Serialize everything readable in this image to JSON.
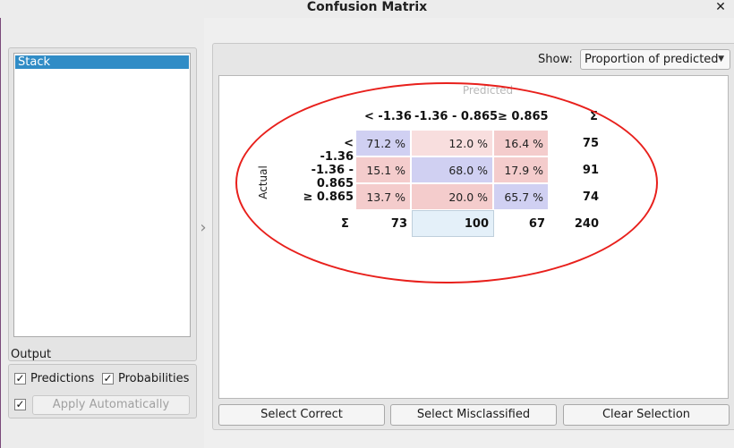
{
  "window": {
    "title": "Confusion Matrix",
    "close_glyph": "✕"
  },
  "learners": {
    "items": [
      "Stack"
    ],
    "selected": "Stack"
  },
  "output": {
    "title": "Output",
    "predictions_label": "Predictions",
    "predictions_checked": true,
    "probabilities_label": "Probabilities",
    "probabilities_checked": true,
    "auto_checked": true,
    "apply_label": "Apply Automatically"
  },
  "status": {
    "help_icon": "help-icon",
    "report_icon": "report-icon",
    "output_icon": "output-icon",
    "output_text": "-"
  },
  "show": {
    "label": "Show:",
    "value": "Proportion of predicted"
  },
  "matrix": {
    "predicted_label": "Predicted",
    "actual_label": "Actual",
    "sum_symbol": "Σ",
    "col_headers": [
      "< -1.36",
      "-1.36 - 0.865",
      "≥ 0.865"
    ],
    "rows": [
      {
        "label": "< -1.36",
        "cells": [
          "71.2 %",
          "12.0 %",
          "16.4 %"
        ],
        "total": "75"
      },
      {
        "label": "-1.36 - 0.865",
        "cells": [
          "15.1 %",
          "68.0 %",
          "17.9 %"
        ],
        "total": "91"
      },
      {
        "label": "≥ 0.865",
        "cells": [
          "13.7 %",
          "20.0 %",
          "65.7 %"
        ],
        "total": "74"
      }
    ],
    "col_totals": [
      "73",
      "100",
      "67"
    ],
    "grand_total": "240",
    "colors": {
      "correct": "#d0d0f2",
      "miss_light": "#f8dede",
      "miss": "#f4cccc",
      "selected_total": "#e4f0f9"
    }
  },
  "buttons": {
    "select_correct": "Select Correct",
    "select_misclassified": "Select Misclassified",
    "clear_selection": "Clear Selection"
  },
  "annotation_color": "#e8201c"
}
